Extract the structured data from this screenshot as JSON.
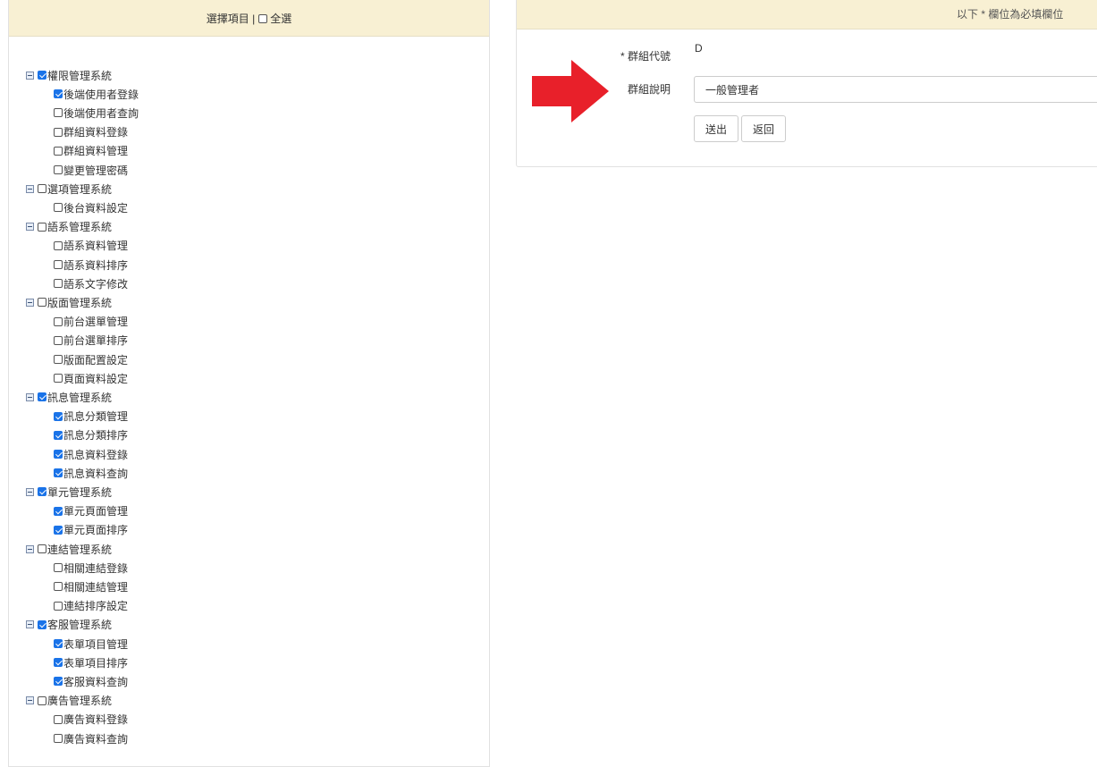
{
  "left_header": {
    "text": "選擇項目 |",
    "select_all_label": "全選",
    "select_all_checked": false
  },
  "tree": [
    {
      "label": "權限管理系統",
      "checked": true,
      "children": [
        {
          "label": "後端使用者登錄",
          "checked": true
        },
        {
          "label": "後端使用者查詢",
          "checked": false
        },
        {
          "label": "群組資料登錄",
          "checked": false
        },
        {
          "label": "群組資料管理",
          "checked": false
        },
        {
          "label": "變更管理密碼",
          "checked": false
        }
      ]
    },
    {
      "label": "選項管理系統",
      "checked": false,
      "children": [
        {
          "label": "後台資料設定",
          "checked": false
        }
      ]
    },
    {
      "label": "語系管理系統",
      "checked": false,
      "children": [
        {
          "label": "語系資料管理",
          "checked": false
        },
        {
          "label": "語系資料排序",
          "checked": false
        },
        {
          "label": "語系文字修改",
          "checked": false
        }
      ]
    },
    {
      "label": "版面管理系統",
      "checked": false,
      "children": [
        {
          "label": "前台選單管理",
          "checked": false
        },
        {
          "label": "前台選單排序",
          "checked": false
        },
        {
          "label": "版面配置設定",
          "checked": false
        },
        {
          "label": "頁面資料設定",
          "checked": false
        }
      ]
    },
    {
      "label": "訊息管理系統",
      "checked": true,
      "children": [
        {
          "label": "訊息分類管理",
          "checked": true
        },
        {
          "label": "訊息分類排序",
          "checked": true
        },
        {
          "label": "訊息資料登錄",
          "checked": true
        },
        {
          "label": "訊息資料查詢",
          "checked": true
        }
      ]
    },
    {
      "label": "單元管理系統",
      "checked": true,
      "children": [
        {
          "label": "單元頁面管理",
          "checked": true
        },
        {
          "label": "單元頁面排序",
          "checked": true
        }
      ]
    },
    {
      "label": "連結管理系統",
      "checked": false,
      "children": [
        {
          "label": "相關連結登錄",
          "checked": false
        },
        {
          "label": "相關連結管理",
          "checked": false
        },
        {
          "label": "連結排序設定",
          "checked": false
        }
      ]
    },
    {
      "label": "客服管理系統",
      "checked": true,
      "children": [
        {
          "label": "表單項目管理",
          "checked": true
        },
        {
          "label": "表單項目排序",
          "checked": true
        },
        {
          "label": "客服資料查詢",
          "checked": true
        }
      ]
    },
    {
      "label": "廣告管理系統",
      "checked": false,
      "children": [
        {
          "label": "廣告資料登錄",
          "checked": false
        },
        {
          "label": "廣告資料查詢",
          "checked": false
        }
      ]
    }
  ],
  "form": {
    "required_note": "以下 * 欄位為必填欄位",
    "group_code_label": "* 群組代號",
    "group_code_value": "D",
    "group_desc_label": "群組說明",
    "group_desc_value": "一般管理者",
    "submit_label": "送出",
    "back_label": "返回"
  },
  "colors": {
    "header_bg": "#f8f0d3",
    "check_blue": "#1a73e8",
    "arrow_red": "#e8202a"
  }
}
